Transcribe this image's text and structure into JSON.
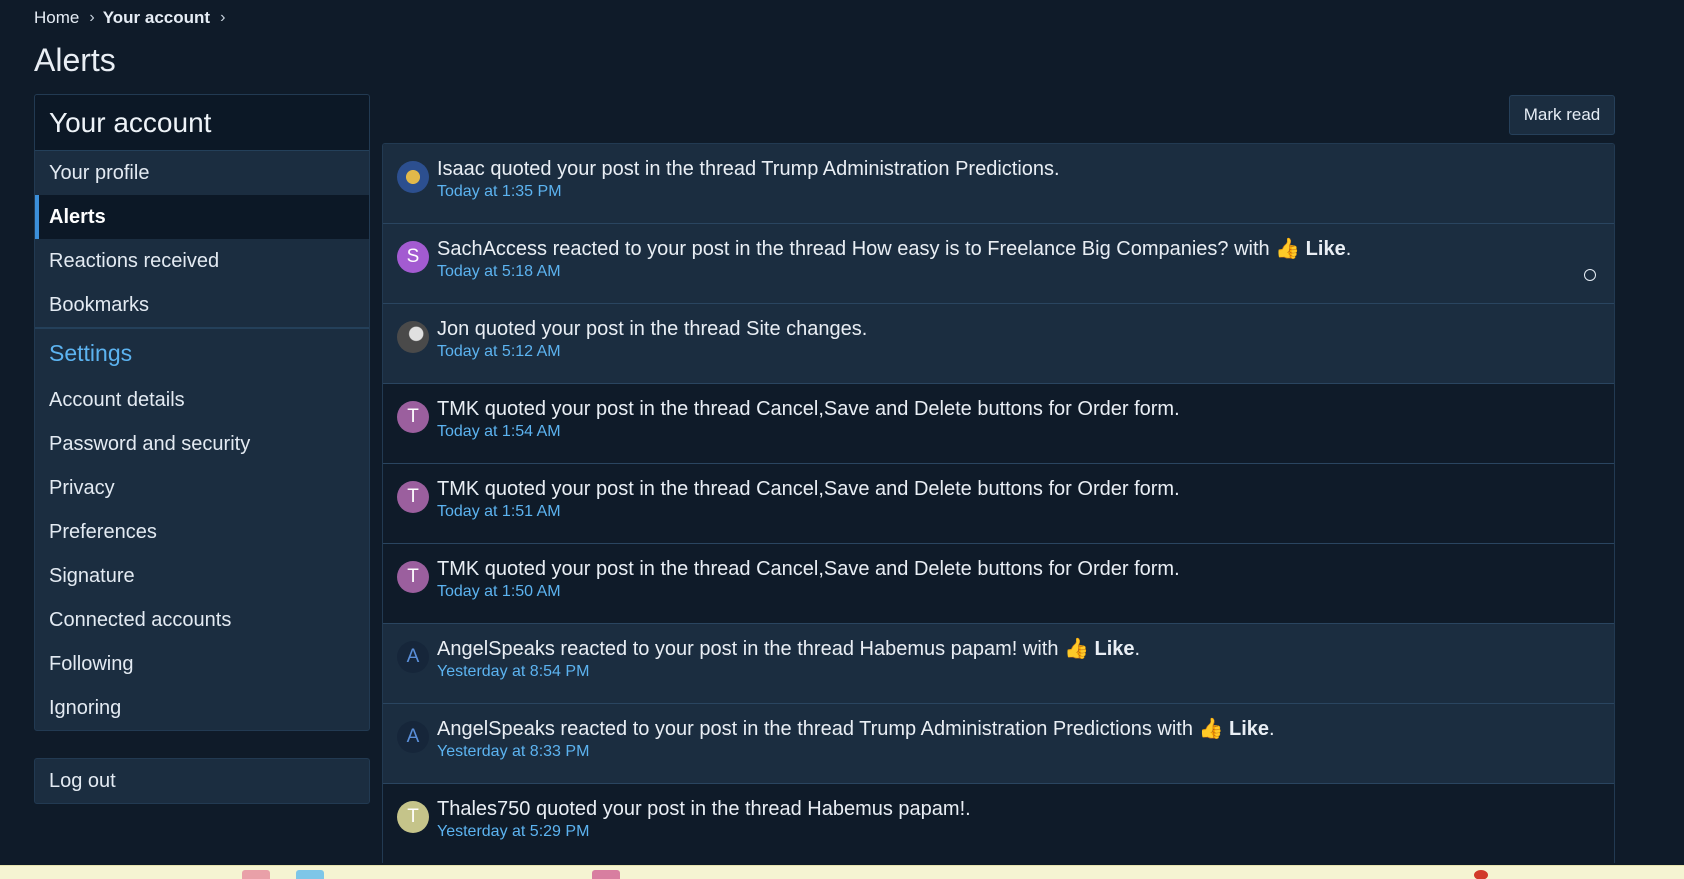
{
  "breadcrumb": {
    "home": "Home",
    "current": "Your account",
    "sep": "›"
  },
  "page_title": "Alerts",
  "sidebar": {
    "header": "Your account",
    "items": [
      {
        "label": "Your profile",
        "active": false
      },
      {
        "label": "Alerts",
        "active": true
      },
      {
        "label": "Reactions received",
        "active": false
      },
      {
        "label": "Bookmarks",
        "active": false
      }
    ],
    "settings_title": "Settings",
    "settings_items": [
      "Account details",
      "Password and security",
      "Privacy",
      "Preferences",
      "Signature",
      "Connected accounts",
      "Following",
      "Ignoring"
    ],
    "logout": "Log out"
  },
  "mark_read": "Mark read",
  "alerts": [
    {
      "user": "Isaac",
      "text": " quoted your post in the thread Trump Administration Predictions.",
      "reaction": "",
      "tail": "",
      "time": "Today at 1:35 PM",
      "unread": true,
      "avatar_letter": "",
      "avatar_color": "#2c4f8f"
    },
    {
      "user": "SachAccess",
      "text": " reacted to your post in the thread How easy is to Freelance Big Companies? with ",
      "reaction": "👍 Like",
      "tail": ".",
      "time": "Today at 5:18 AM",
      "unread": true,
      "avatar_letter": "S",
      "avatar_color": "#a35bd1"
    },
    {
      "user": "Jon",
      "text": " quoted your post in the thread Site changes.",
      "reaction": "",
      "tail": "",
      "time": "Today at 5:12 AM",
      "unread": true,
      "avatar_letter": "",
      "avatar_color": "#6b6b6b"
    },
    {
      "user": "TMK",
      "text": " quoted your post in the thread Cancel,Save and Delete buttons for Order form.",
      "reaction": "",
      "tail": "",
      "time": "Today at 1:54 AM",
      "unread": false,
      "avatar_letter": "T",
      "avatar_color": "#9b5f9e"
    },
    {
      "user": "TMK",
      "text": " quoted your post in the thread Cancel,Save and Delete buttons for Order form.",
      "reaction": "",
      "tail": "",
      "time": "Today at 1:51 AM",
      "unread": false,
      "avatar_letter": "T",
      "avatar_color": "#9b5f9e"
    },
    {
      "user": "TMK",
      "text": " quoted your post in the thread Cancel,Save and Delete buttons for Order form.",
      "reaction": "",
      "tail": "",
      "time": "Today at 1:50 AM",
      "unread": false,
      "avatar_letter": "T",
      "avatar_color": "#9b5f9e"
    },
    {
      "user": "AngelSpeaks",
      "text": " reacted to your post in the thread Habemus papam! with ",
      "reaction": "👍 Like",
      "tail": ".",
      "time": "Yesterday at 8:54 PM",
      "unread": true,
      "avatar_letter": "A",
      "avatar_color": "#16263a"
    },
    {
      "user": "AngelSpeaks",
      "text": " reacted to your post in the thread Trump Administration Predictions with ",
      "reaction": "👍 Like",
      "tail": ".",
      "time": "Yesterday at 8:33 PM",
      "unread": true,
      "avatar_letter": "A",
      "avatar_color": "#16263a"
    },
    {
      "user": "Thales750",
      "text": " quoted your post in the thread Habemus papam!.",
      "reaction": "",
      "tail": "",
      "time": "Yesterday at 5:29 PM",
      "unread": false,
      "avatar_letter": "T",
      "avatar_color": "#c5c48a"
    }
  ],
  "colors": {
    "accent": "#5cb3f0",
    "background": "#0f1b29",
    "panel": "#1b2d40"
  }
}
